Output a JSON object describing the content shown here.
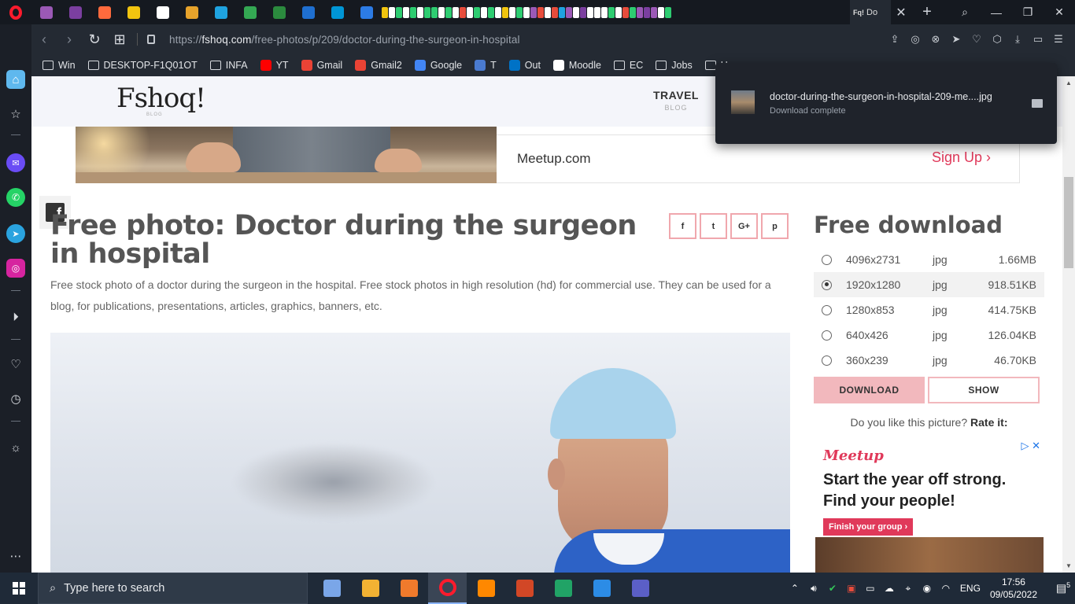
{
  "browser": {
    "active_tab_title": "Do",
    "tab_close": "✕",
    "new_tab": "+",
    "url_prefix": "https://",
    "url_domain": "fshoq.com",
    "url_path": "/free-photos/p/209/doctor-during-the-surgeon-in-hospital",
    "tab_favicon_colors": [
      "#9b59b6",
      "#7b3fa0",
      "#ff6a3d",
      "#f1c40f",
      "#ffffff",
      "#e7a32b",
      "#1fa3e0",
      "#34a853",
      "#2b8a3e",
      "#1f6fd0",
      "#0096d6",
      "#2c7be5"
    ],
    "tab_mini_colors": [
      "#f1c40f",
      "#ffffff",
      "#2ecc71",
      "#ffffff",
      "#2ecc71",
      "#ffffff",
      "#2ecc71",
      "#2ecc71",
      "#ffffff",
      "#2ecc71",
      "#ffffff",
      "#e74c3c",
      "#ffffff",
      "#2ecc71",
      "#ffffff",
      "#2ecc71",
      "#ffffff",
      "#f1c40f",
      "#ffffff",
      "#2ecc71",
      "#ffffff",
      "#9b59b6",
      "#e74c3c",
      "#ffffff",
      "#e74c3c",
      "#1fa3e0",
      "#9b59b6",
      "#ffffff",
      "#7b3fa0",
      "#ffffff",
      "#ffffff",
      "#ffffff",
      "#2ecc71",
      "#ffffff",
      "#e74c3c",
      "#2ecc71",
      "#9b59b6",
      "#7b3fa0",
      "#9b59b6",
      "#ffffff",
      "#2ecc71"
    ]
  },
  "bookmarks": [
    {
      "label": "Win",
      "type": "folder"
    },
    {
      "label": "DESKTOP-F1Q01OT",
      "type": "folder"
    },
    {
      "label": "INFA",
      "type": "folder"
    },
    {
      "label": "YT",
      "type": "icon",
      "color": "#ff0000"
    },
    {
      "label": "Gmail",
      "type": "icon",
      "color": "#ea4335"
    },
    {
      "label": "Gmail2",
      "type": "icon",
      "color": "#ea4335"
    },
    {
      "label": "Google",
      "type": "icon",
      "color": "#4285f4"
    },
    {
      "label": "T",
      "type": "icon",
      "color": "#4a7bd0"
    },
    {
      "label": "Out",
      "type": "icon",
      "color": "#0072c6"
    },
    {
      "label": "Moodle",
      "type": "icon",
      "color": "#ffffff"
    },
    {
      "label": "EC",
      "type": "folder"
    },
    {
      "label": "Jobs",
      "type": "folder"
    },
    {
      "label": "Hou",
      "type": "folder"
    }
  ],
  "download_popup": {
    "filename": "doctor-during-the-surgeon-in-hospital-209-me....jpg",
    "status": "Download complete"
  },
  "site": {
    "logo": "Fshoq!",
    "logo_sub": "BLOG",
    "nav_title": "TRAVEL",
    "nav_sub": "BLOG",
    "top_ad": {
      "name": "Meetup.com",
      "cta": "Sign Up"
    },
    "fb_icon_glyph": "f",
    "title": "Free photo: Doctor during the surgeon in hospital",
    "description": "Free stock photo of a doctor during the surgeon in the hospital. Free stock photos in high resolution (hd) for commercial use. They can be used for a blog, for publications, presentations, articles, graphics, banners, etc.",
    "share_buttons": [
      "f",
      "t",
      "G+",
      "p"
    ]
  },
  "download_panel": {
    "title": "Free download",
    "sizes": [
      {
        "dim": "4096x2731",
        "fmt": "jpg",
        "size": "1.66MB",
        "selected": false
      },
      {
        "dim": "1920x1280",
        "fmt": "jpg",
        "size": "918.51KB",
        "selected": true
      },
      {
        "dim": "1280x853",
        "fmt": "jpg",
        "size": "414.75KB",
        "selected": false
      },
      {
        "dim": "640x426",
        "fmt": "jpg",
        "size": "126.04KB",
        "selected": false
      },
      {
        "dim": "360x239",
        "fmt": "jpg",
        "size": "46.70KB",
        "selected": false
      }
    ],
    "download_label": "DOWNLOAD",
    "show_label": "SHOW",
    "rate_prompt": "Do you like this picture?",
    "rate_label": "Rate it:"
  },
  "side_ad": {
    "brand": "Meetup",
    "headline": "Start the year off strong. Find your people!",
    "cta": "Finish your group ›",
    "ad_choices": "▷ ✕"
  },
  "taskbar": {
    "search_placeholder": "Type here to search",
    "lang": "ENG",
    "time": "17:56",
    "date": "09/05/2022",
    "notifications": "5",
    "app_colors": [
      "#7aa6e8",
      "#f2b233",
      "#f07a2c",
      "#ff1b2d",
      "#ff8800",
      "#d24726",
      "#21a366",
      "#2c8ce6",
      "#5b5fc7"
    ]
  },
  "sidebar": {
    "icons": [
      "home-icon",
      "star-icon",
      "messenger-icon",
      "whatsapp-icon",
      "telegram-icon",
      "instagram-icon",
      "player-icon",
      "heart-icon",
      "history-icon",
      "lightbulb-icon",
      "more-icon"
    ]
  }
}
